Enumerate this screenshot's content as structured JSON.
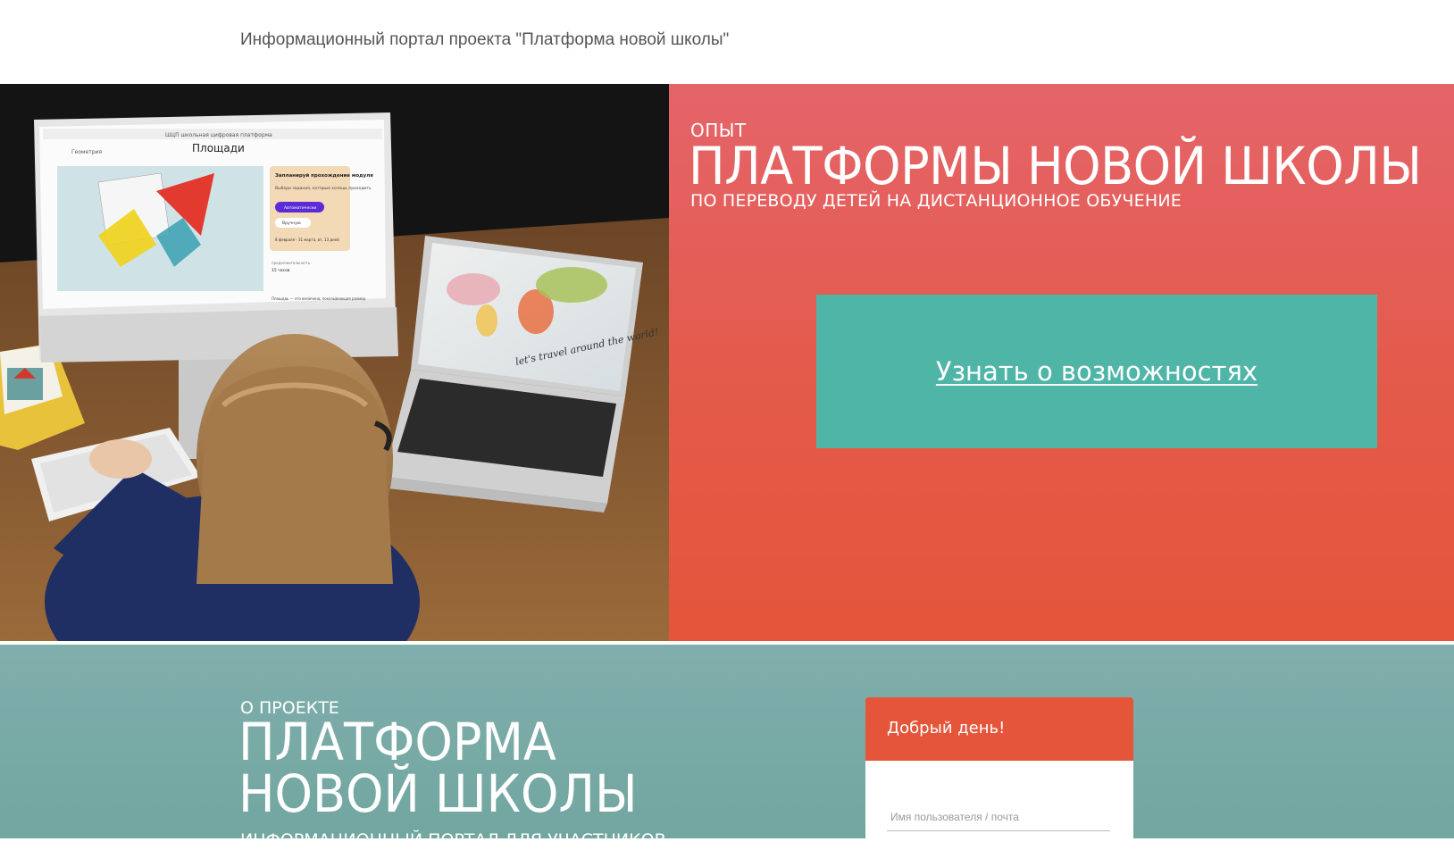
{
  "header": {
    "title": "Информационный портал проекта \"Платформа новой школы\""
  },
  "hero": {
    "eyebrow": "ОПЫТ",
    "headline": "ПЛАТФОРМЫ НОВОЙ ШКОЛЫ",
    "subtitle": "ПО ПЕРЕВОДУ ДЕТЕЙ НА ДИСТАНЦИОННОЕ ОБУЧЕНИЕ",
    "cta_label": "Узнать о возможностях",
    "screen": {
      "tab_text": "ШЦП школьная цифровая платформа",
      "back_label": "Геометрия",
      "page_title": "Площади",
      "card_title": "Запланируй прохождение модуля",
      "card_text": "Выбери задания, которые хочешь проходить",
      "auto_button": "Автоматически",
      "manual_button": "Вручную",
      "dates": "8 февраля - 31 марта, вт, 13 дней",
      "duration_label": "продолжительность",
      "duration_value": "15 часов",
      "desc": "Площадь — это величина, показывающая размер"
    },
    "laptop_caption": "let's travel around the world!"
  },
  "about": {
    "eyebrow": "О ПРОЕКТЕ",
    "title_line1": "ПЛАТФОРМА",
    "title_line2": "НОВОЙ ШКОЛЫ",
    "subtitle": "ИНФОРМАЦИОННЫЙ ПОРТАЛ ДЛЯ УЧАСТНИКОВ"
  },
  "login": {
    "greeting": "Добрый день!",
    "username_placeholder": "Имя пользователя / почта"
  }
}
